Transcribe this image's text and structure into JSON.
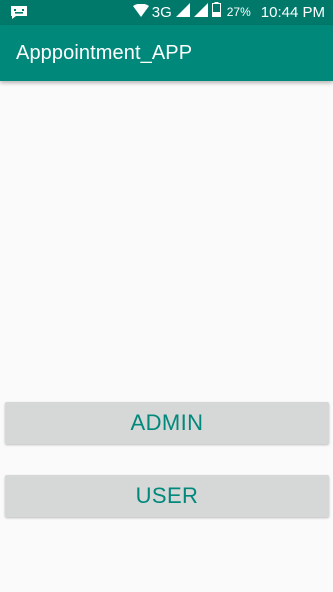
{
  "status_bar": {
    "notification_icon": "message-notification-icon",
    "wifi_icon": "wifi-icon",
    "network": "3G",
    "signal_icon": "cell-signal-icon",
    "signal2_icon": "cell-signal-icon",
    "battery_icon": "battery-icon",
    "battery_percent": "27%",
    "time": "10:44 PM"
  },
  "app_bar": {
    "title": "Apppointment_APP",
    "color": "#00897b",
    "status_color": "#00796b"
  },
  "buttons": {
    "admin_label": "ADMIN",
    "user_label": "USER",
    "text_color": "#00897b",
    "background": "#d6d7d7"
  }
}
